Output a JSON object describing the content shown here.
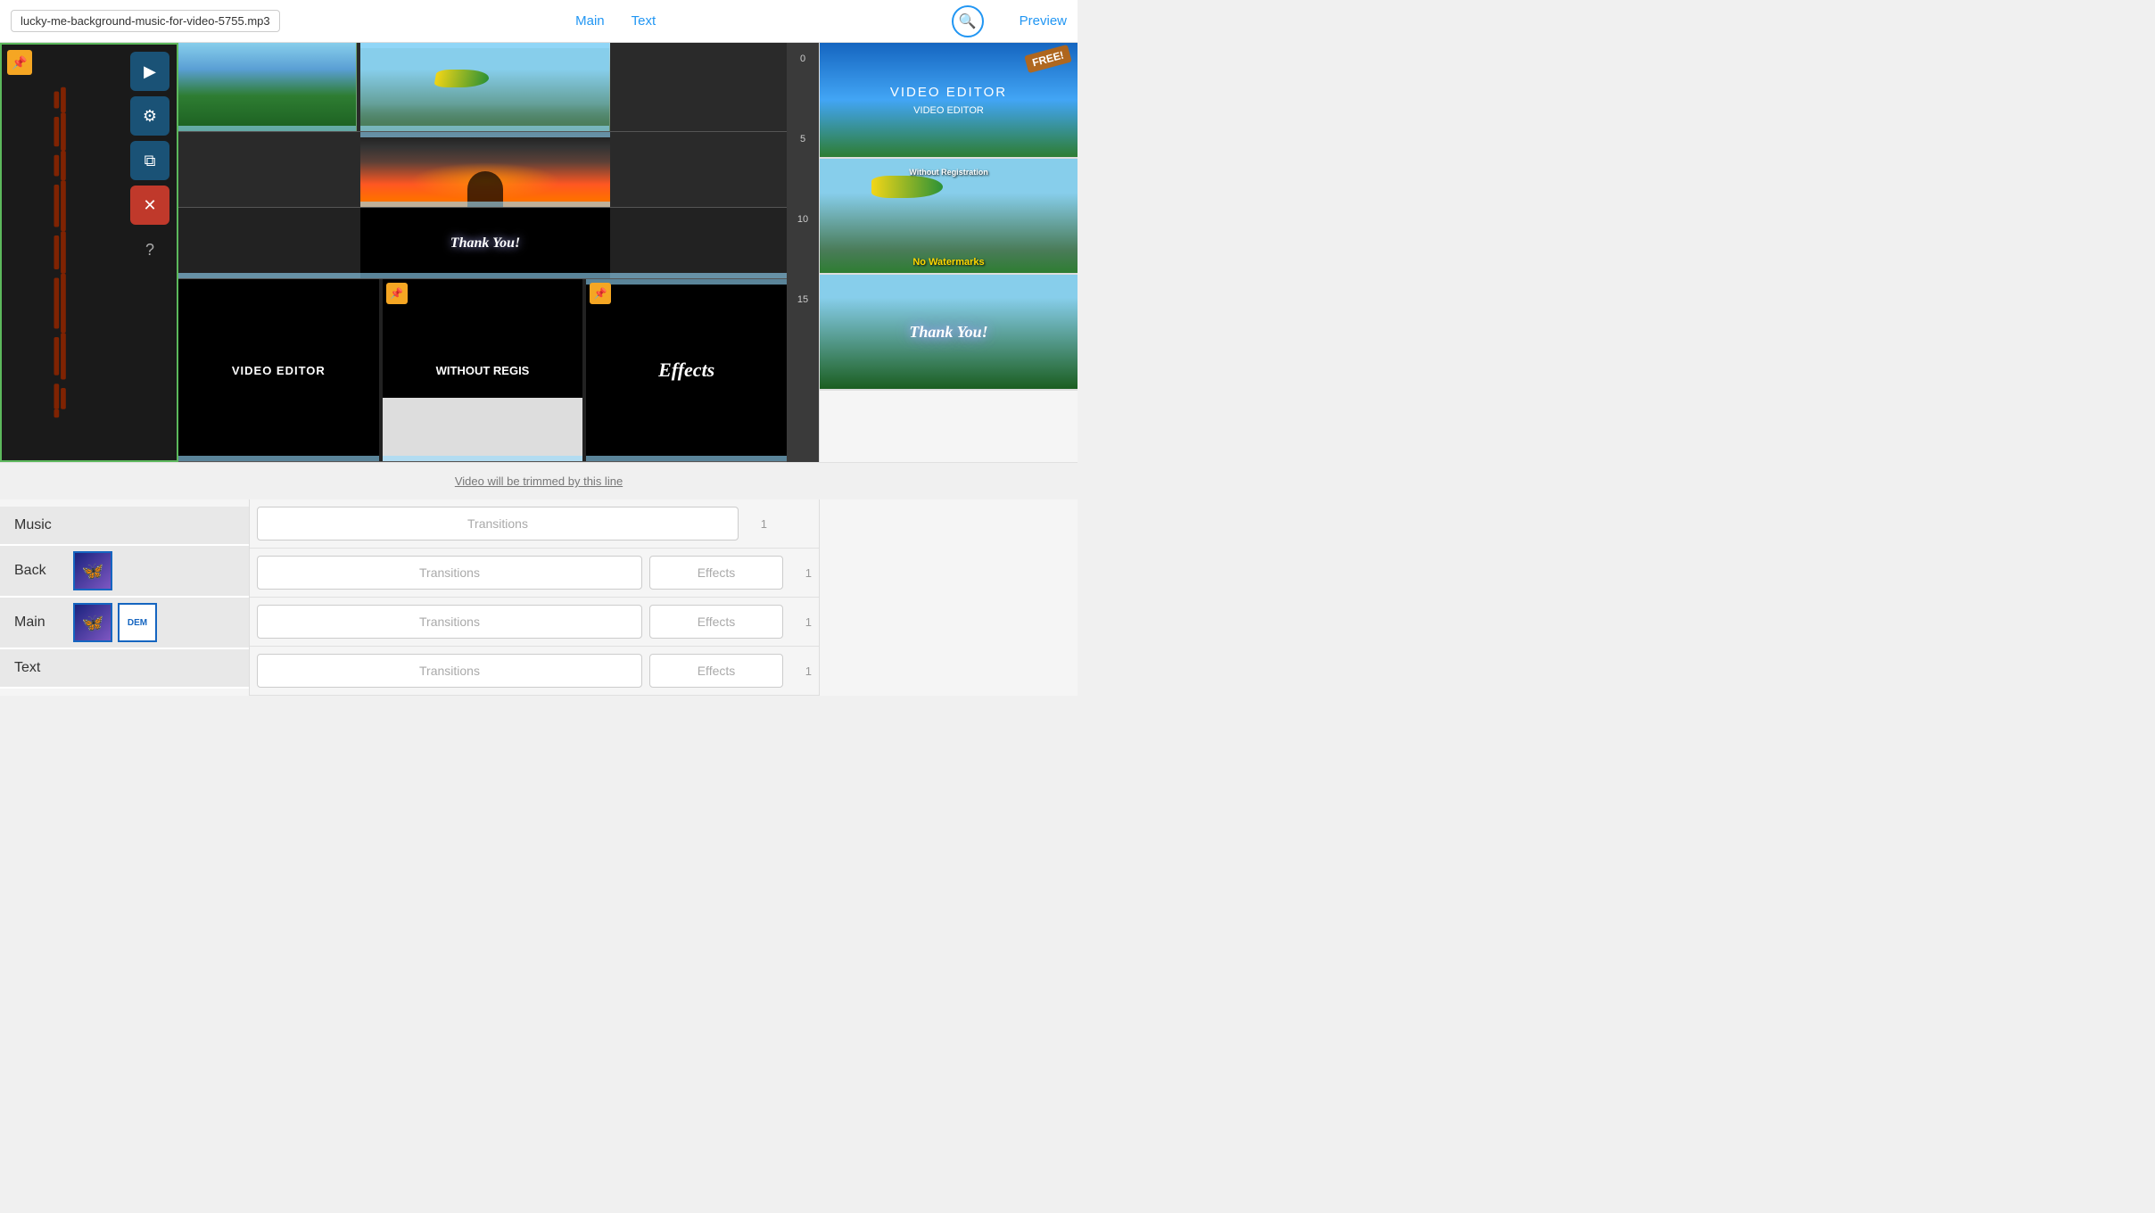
{
  "header": {
    "filename": "lucky-me-background-music-for-video-5755.mp3",
    "nav": {
      "main": "Main",
      "text": "Text",
      "preview": "Preview"
    },
    "search_icon": "🔍"
  },
  "timeline": {
    "trim_line_text": "Video will be trimmed by this line",
    "ruler": {
      "marks": [
        "0",
        "5",
        "10",
        "15"
      ]
    }
  },
  "controls": {
    "play": "▶",
    "settings": "⚙",
    "copy": "⧉",
    "delete": "✕",
    "help": "?"
  },
  "clips": [
    {
      "id": "clip-mountain",
      "type": "video",
      "label": ""
    },
    {
      "id": "clip-glider",
      "type": "video",
      "label": ""
    },
    {
      "id": "clip-fire",
      "type": "video",
      "label": ""
    },
    {
      "id": "clip-thankyou",
      "type": "text",
      "label": "Thank You!"
    },
    {
      "id": "clip-video-editor",
      "type": "text",
      "label": "VIDEO EDITOR"
    },
    {
      "id": "clip-without",
      "type": "text",
      "label": "WITHOUT REGIS..."
    },
    {
      "id": "clip-effects",
      "type": "text",
      "label": "Effects"
    }
  ],
  "preview_panel": {
    "thumbs": [
      {
        "id": "thumb-1",
        "labels": [
          "FREE!",
          "VIDEO EDITOR"
        ],
        "type": "landscape"
      },
      {
        "id": "thumb-2",
        "labels": [
          "Without Registration",
          "No Watermarks"
        ],
        "type": "glider"
      },
      {
        "id": "thumb-3",
        "labels": [
          "Thank You!"
        ],
        "type": "thankyou"
      }
    ]
  },
  "bottom": {
    "menu_items": [
      "Music",
      "Back",
      "Main",
      "Text"
    ],
    "track_rows": [
      {
        "transitions_label": "Transitions",
        "effects_label": "",
        "number": "1"
      },
      {
        "transitions_label": "Transitions",
        "effects_label": "Effects",
        "number": "1"
      },
      {
        "transitions_label": "Transitions",
        "effects_label": "Effects",
        "number": "1"
      },
      {
        "transitions_label": "Transitions",
        "effects_label": "Effects",
        "number": "1"
      }
    ]
  }
}
